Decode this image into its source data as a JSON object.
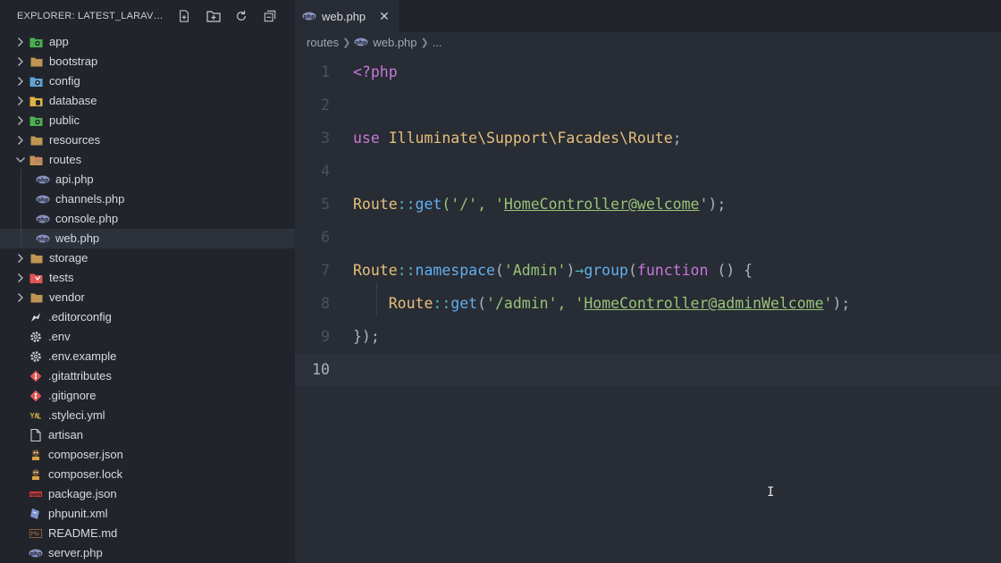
{
  "explorer": {
    "title": "EXPLORER: LATEST_LARAVEL....",
    "actions": [
      "new-file-icon",
      "new-folder-icon",
      "refresh-icon",
      "collapse-all-icon"
    ]
  },
  "tree": [
    {
      "label": "app",
      "type": "folder",
      "expanded": false,
      "icon": "folder-app-icon",
      "color": "#4caf50"
    },
    {
      "label": "bootstrap",
      "type": "folder",
      "expanded": false,
      "icon": "folder-icon",
      "color": "#c09553"
    },
    {
      "label": "config",
      "type": "folder",
      "expanded": false,
      "icon": "folder-config-icon",
      "color": "#5fa3d3"
    },
    {
      "label": "database",
      "type": "folder",
      "expanded": false,
      "icon": "folder-database-icon",
      "color": "#e0b444"
    },
    {
      "label": "public",
      "type": "folder",
      "expanded": false,
      "icon": "folder-public-icon",
      "color": "#4caf50"
    },
    {
      "label": "resources",
      "type": "folder",
      "expanded": false,
      "icon": "folder-icon",
      "color": "#c09553"
    },
    {
      "label": "routes",
      "type": "folder",
      "expanded": true,
      "icon": "folder-routes-icon",
      "color": "#e06c75"
    },
    {
      "label": "api.php",
      "type": "file",
      "icon": "php-file-icon",
      "color": "#8892bf"
    },
    {
      "label": "channels.php",
      "type": "file",
      "icon": "php-file-icon",
      "color": "#8892bf"
    },
    {
      "label": "console.php",
      "type": "file",
      "icon": "php-file-icon",
      "color": "#8892bf"
    },
    {
      "label": "web.php",
      "type": "file",
      "icon": "php-file-icon",
      "color": "#8892bf",
      "selected": true
    },
    {
      "label": "storage",
      "type": "folder",
      "expanded": false,
      "icon": "folder-icon",
      "color": "#c09553"
    },
    {
      "label": "tests",
      "type": "folder",
      "expanded": false,
      "icon": "folder-tests-icon",
      "color": "#e05555"
    },
    {
      "label": "vendor",
      "type": "folder",
      "expanded": false,
      "icon": "folder-icon",
      "color": "#c09553"
    },
    {
      "label": ".editorconfig",
      "type": "file",
      "icon": "editorconfig-icon",
      "color": "#e0e0e0"
    },
    {
      "label": ".env",
      "type": "file",
      "icon": "gear-icon",
      "color": "#c8ccd4"
    },
    {
      "label": ".env.example",
      "type": "file",
      "icon": "gear-icon",
      "color": "#c8ccd4"
    },
    {
      "label": ".gitattributes",
      "type": "file",
      "icon": "git-icon",
      "color": "#e05555"
    },
    {
      "label": ".gitignore",
      "type": "file",
      "icon": "git-icon",
      "color": "#e05555"
    },
    {
      "label": ".styleci.yml",
      "type": "file",
      "icon": "yaml-icon",
      "color": "#e0b444"
    },
    {
      "label": "artisan",
      "type": "file",
      "icon": "file-icon",
      "color": "#c8ccd4"
    },
    {
      "label": "composer.json",
      "type": "file",
      "icon": "composer-icon",
      "color": "#d9a441"
    },
    {
      "label": "composer.lock",
      "type": "file",
      "icon": "composer-icon",
      "color": "#d9a441"
    },
    {
      "label": "package.json",
      "type": "file",
      "icon": "npm-icon",
      "color": "#cb3837"
    },
    {
      "label": "phpunit.xml",
      "type": "file",
      "icon": "phpunit-icon",
      "color": "#7f95d1"
    },
    {
      "label": "README.md",
      "type": "file",
      "icon": "markdown-icon",
      "color": "#8b5a3c"
    },
    {
      "label": "server.php",
      "type": "file",
      "icon": "php-file-icon",
      "color": "#8892bf"
    }
  ],
  "tab": {
    "label": "web.php",
    "close": "✕"
  },
  "breadcrumbs": [
    "routes",
    "web.php",
    "..."
  ],
  "code": {
    "active_line": 10,
    "lines": [
      {
        "n": "1",
        "tokens": [
          {
            "t": "<?php",
            "c": "kw"
          }
        ]
      },
      {
        "n": "2",
        "tokens": []
      },
      {
        "n": "3",
        "tokens": [
          {
            "t": "use ",
            "c": "kw"
          },
          {
            "t": "Illuminate\\Support\\Facades\\Route",
            "c": "cls"
          },
          {
            "t": ";",
            "c": "punc"
          }
        ]
      },
      {
        "n": "4",
        "tokens": []
      },
      {
        "n": "5",
        "tokens": [
          {
            "t": "Route",
            "c": "cls"
          },
          {
            "t": "::",
            "c": "op"
          },
          {
            "t": "get",
            "c": "fn"
          },
          {
            "t": "('/', '",
            "c": "str"
          },
          {
            "t": "HomeController@welcome",
            "c": "strlink"
          },
          {
            "t": "'",
            "c": "str"
          },
          {
            "t": ");",
            "c": "punc"
          }
        ]
      },
      {
        "n": "6",
        "tokens": []
      },
      {
        "n": "7",
        "tokens": [
          {
            "t": "Route",
            "c": "cls"
          },
          {
            "t": "::",
            "c": "op"
          },
          {
            "t": "namespace",
            "c": "fn"
          },
          {
            "t": "(",
            "c": "punc"
          },
          {
            "t": "'Admin'",
            "c": "str"
          },
          {
            "t": ")",
            "c": "punc"
          },
          {
            "t": "→",
            "c": "op"
          },
          {
            "t": "group",
            "c": "fn"
          },
          {
            "t": "(",
            "c": "punc"
          },
          {
            "t": "function",
            "c": "kw"
          },
          {
            "t": " () {",
            "c": "punc"
          }
        ]
      },
      {
        "n": "8",
        "tokens": [
          {
            "t": "    ",
            "c": "punc"
          },
          {
            "t": "Route",
            "c": "cls"
          },
          {
            "t": "::",
            "c": "op"
          },
          {
            "t": "get",
            "c": "fn"
          },
          {
            "t": "(",
            "c": "punc"
          },
          {
            "t": "'/admin', '",
            "c": "str"
          },
          {
            "t": "HomeController@adminWelcome",
            "c": "strlink"
          },
          {
            "t": "'",
            "c": "str"
          },
          {
            "t": ");",
            "c": "punc"
          }
        ]
      },
      {
        "n": "9",
        "tokens": [
          {
            "t": "});",
            "c": "punc"
          }
        ]
      },
      {
        "n": "10",
        "tokens": []
      }
    ]
  }
}
